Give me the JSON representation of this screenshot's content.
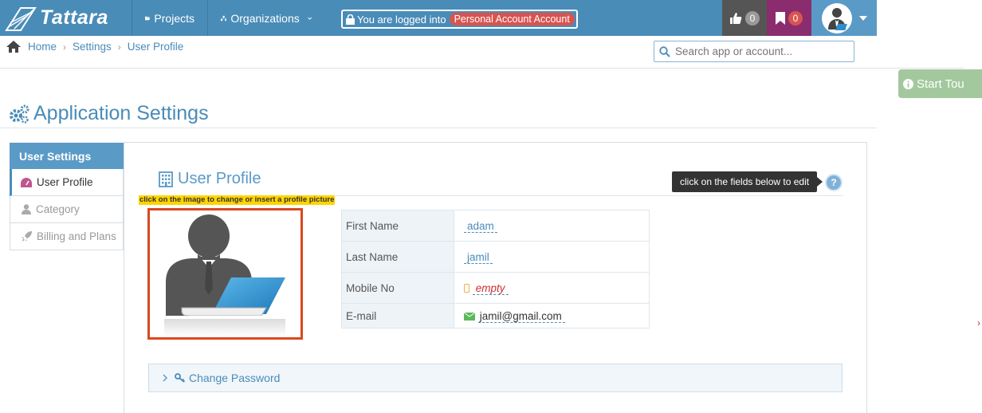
{
  "app": {
    "brand": "Tattara"
  },
  "nav": {
    "projects": "Projects",
    "organizations": "Organizations"
  },
  "login": {
    "prefix": "You are logged into",
    "account": "Personal Account Account"
  },
  "counters": {
    "likes": "0",
    "bookmarks": "0"
  },
  "breadcrumb": {
    "home": "Home",
    "settings": "Settings",
    "current": "User Profile"
  },
  "search": {
    "placeholder": "Search app or account..."
  },
  "tour": {
    "label": "Start Tou"
  },
  "page": {
    "title": "Application Settings"
  },
  "sidebar": {
    "heading": "User Settings",
    "items": [
      {
        "label": "User Profile"
      },
      {
        "label": "Category"
      },
      {
        "label": "Billing and Plans"
      }
    ]
  },
  "profile": {
    "title": "User Profile",
    "tip": "click on the fields below to edit",
    "help": "?",
    "image_hint": "click on the image to change or insert a profile picture",
    "fields": [
      {
        "label": "First Name",
        "value": "adam"
      },
      {
        "label": "Last Name",
        "value": "jamil"
      },
      {
        "label": "Mobile No",
        "value": "empty"
      },
      {
        "label": "E-mail",
        "value": "jamil@gmail.com"
      }
    ],
    "change_password": "Change Password"
  },
  "colors": {
    "topbar": "#4a8cb8",
    "accent": "#5a9ac7",
    "badge": "#d9534f",
    "avatar_border": "#d9481f",
    "tour": "#a3c89e"
  }
}
